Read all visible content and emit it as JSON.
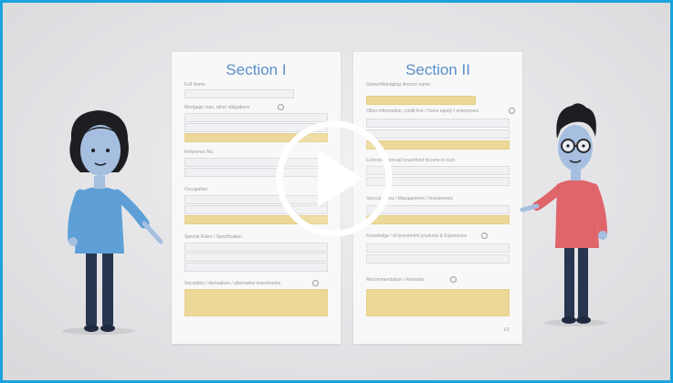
{
  "video": {
    "sections": [
      {
        "title": "Section I",
        "labels": [
          "Full Name",
          "Mortgage loan, other obligations",
          "Reference No.",
          "Occupation",
          "Special Rules / Specification",
          "Securities / derivatives / alternative investments"
        ]
      },
      {
        "title": "Section II",
        "labels": [
          "Owner/Managing director name",
          "Other information, credit line / home equity / enterprises",
          "Estimated annual household income in euro",
          "Special Rules / Management / Investments",
          "Knowledge / of investment products & Experience",
          "Recommendation / Remarks"
        ],
        "page_number": "1/2"
      }
    ],
    "play_icon": "play-icon",
    "colors": {
      "border": "#1aa3dc",
      "highlight": "#ecd99a",
      "title": "#5b8fc7"
    }
  }
}
